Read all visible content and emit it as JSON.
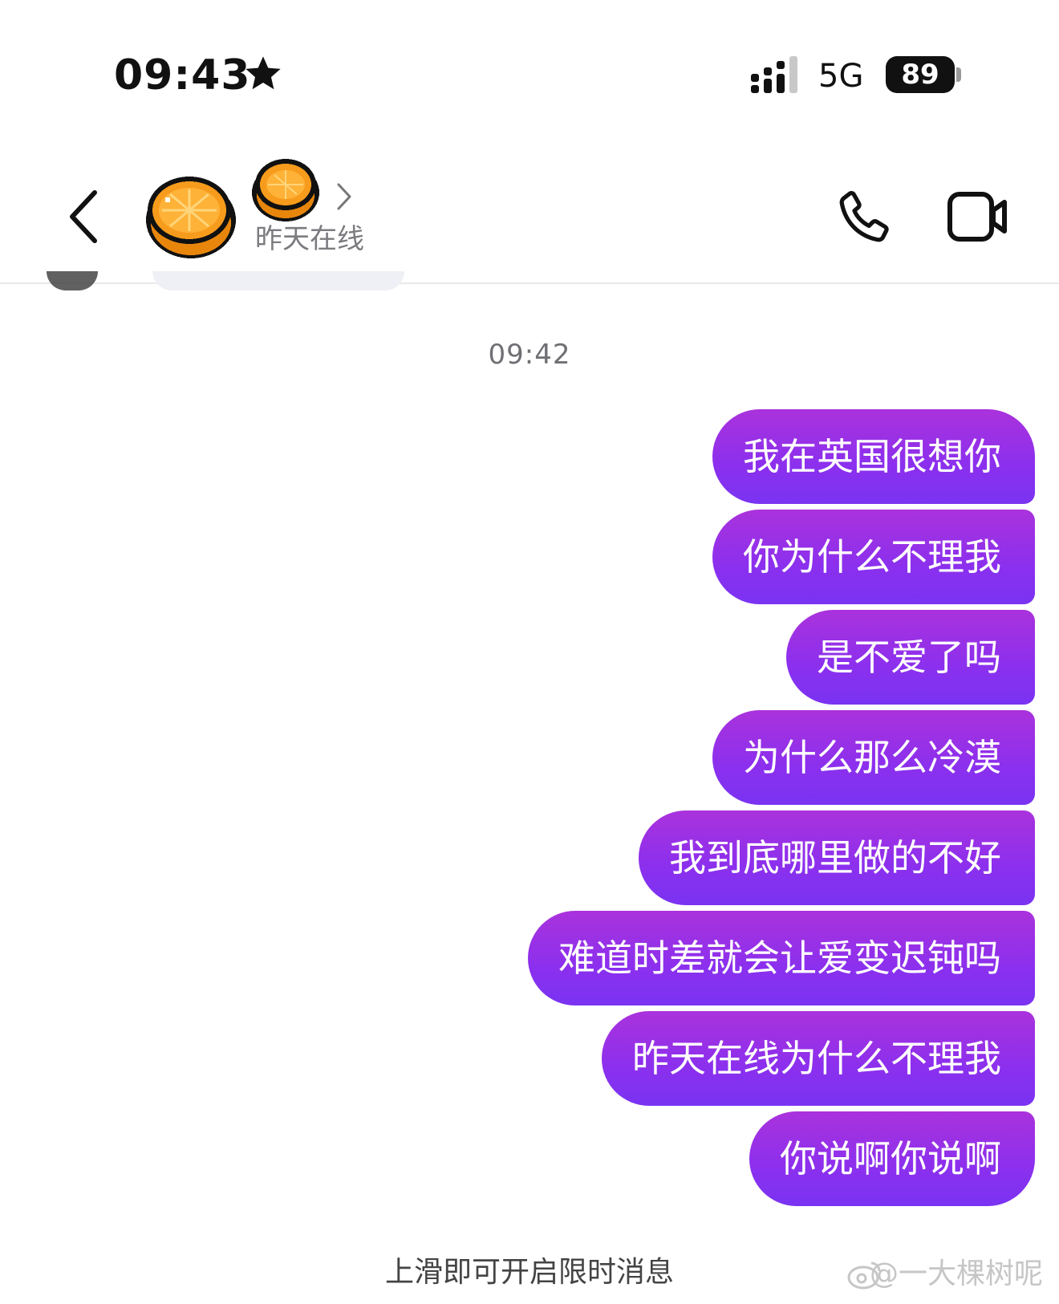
{
  "status_bar": {
    "time": "09:43",
    "network": "5G",
    "battery": "89"
  },
  "header": {
    "presence": "昨天在线"
  },
  "chat": {
    "timestamp": "09:42",
    "messages": [
      "我在英国很想你",
      "你为什么不理我",
      "是不爱了吗",
      "为什么那么冷漠",
      "我到底哪里做的不好",
      "难道时差就会让爱变迟钝吗",
      "昨天在线为什么不理我",
      "你说啊你说啊"
    ]
  },
  "footer": {
    "hint": "上滑即可开启限时消息",
    "watermark": "@一大棵树呢"
  },
  "colors": {
    "bubble_top": "#aa32dc",
    "bubble_bottom": "#7a33f2",
    "presence_text": "#7b7b80"
  }
}
